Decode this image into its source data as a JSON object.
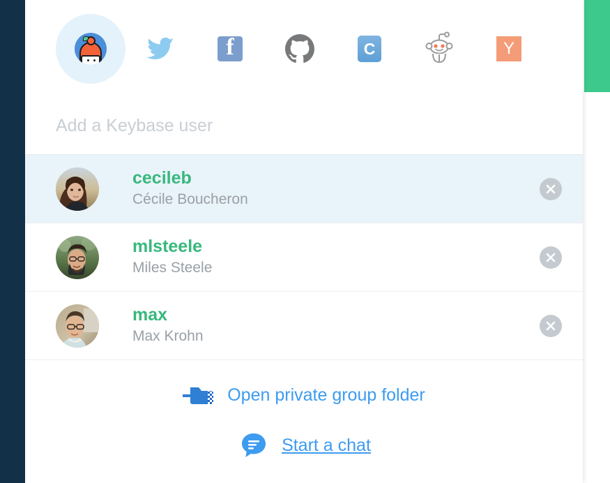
{
  "window": {
    "left_rail_color": "#123149",
    "green_panel_color": "#3dc98b",
    "accent_blue": "#3d9bf0",
    "username_green": "#37b87c",
    "selected_row_bg": "#e9f3fa"
  },
  "services": [
    {
      "name": "keybase",
      "label": "Keybase",
      "icon": "keybase-icon",
      "selected": true
    },
    {
      "name": "twitter",
      "label": "Twitter",
      "icon": "twitter-icon",
      "selected": false,
      "color": "#8ecbf0"
    },
    {
      "name": "facebook",
      "label": "Facebook",
      "icon": "facebook-icon",
      "selected": false,
      "color": "#7c9ecd",
      "glyph": "f"
    },
    {
      "name": "github",
      "label": "GitHub",
      "icon": "github-icon",
      "selected": false,
      "color": "#77797b"
    },
    {
      "name": "coinbase",
      "label": "Coinbase",
      "icon": "coinbase-icon",
      "selected": false,
      "color": "#5e9fd6",
      "glyph": "C"
    },
    {
      "name": "reddit",
      "label": "Reddit",
      "icon": "reddit-icon",
      "selected": false,
      "color": "#9b9b9b"
    },
    {
      "name": "hackernews",
      "label": "Hacker News",
      "icon": "hackernews-icon",
      "selected": false,
      "color": "#f49c77",
      "glyph": "Y"
    }
  ],
  "search": {
    "placeholder": "Add a Keybase user",
    "value": ""
  },
  "users": [
    {
      "username": "cecileb",
      "fullname": "Cécile Boucheron",
      "selected": true,
      "remove_label": "Remove cecileb"
    },
    {
      "username": "mlsteele",
      "fullname": "Miles Steele",
      "selected": false,
      "remove_label": "Remove mlsteele"
    },
    {
      "username": "max",
      "fullname": "Max Krohn",
      "selected": false,
      "remove_label": "Remove max"
    }
  ],
  "actions": [
    {
      "key": "open_folder",
      "label": "Open private group folder",
      "icon": "folder-arrow-icon",
      "underlined": false
    },
    {
      "key": "start_chat",
      "label": "Start a chat",
      "icon": "chat-bubble-icon",
      "underlined": true
    }
  ]
}
